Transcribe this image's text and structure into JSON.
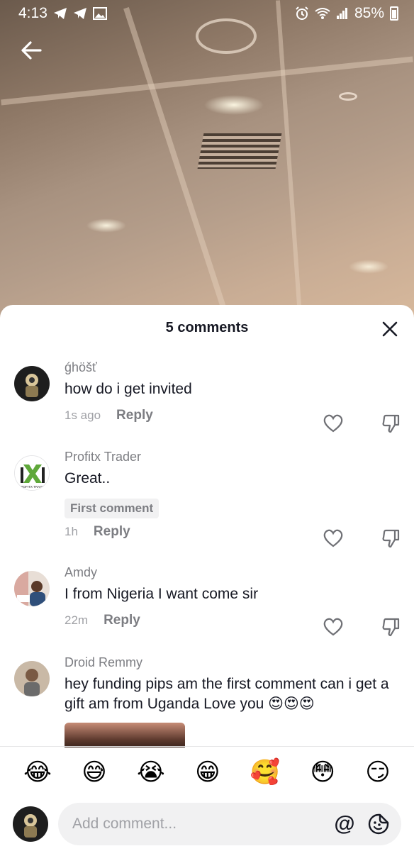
{
  "status_bar": {
    "time": "4:13",
    "battery": "85%"
  },
  "sheet": {
    "title": "5 comments"
  },
  "comments": [
    {
      "username": "ǵhöšť",
      "text": "how do i get invited",
      "time": "1s ago",
      "reply_label": "Reply"
    },
    {
      "username": "Profitx Trader",
      "text": "Great..",
      "badge": "First comment",
      "time": "1h",
      "reply_label": "Reply",
      "avatar_logo_text": "PROFITX TRADER"
    },
    {
      "username": "Amdy",
      "text": "I from Nigeria I want come sir",
      "time": "22m",
      "reply_label": "Reply"
    },
    {
      "username": "Droid Remmy",
      "text": "hey funding pips am the first comment can i get a gift am from Uganda Love you 😍😍😍"
    }
  ],
  "emoji_bar": [
    "😂",
    "😅",
    "😭",
    "😁",
    "🥰",
    "😳",
    "😏"
  ],
  "input": {
    "placeholder": "Add comment..."
  },
  "icons": {
    "back": "arrow-left-icon",
    "close": "close-icon",
    "like": "heart-outline-icon",
    "dislike": "thumbs-down-outline-icon",
    "mention": "at-sign-icon",
    "sticker": "emoji-sticker-icon"
  }
}
